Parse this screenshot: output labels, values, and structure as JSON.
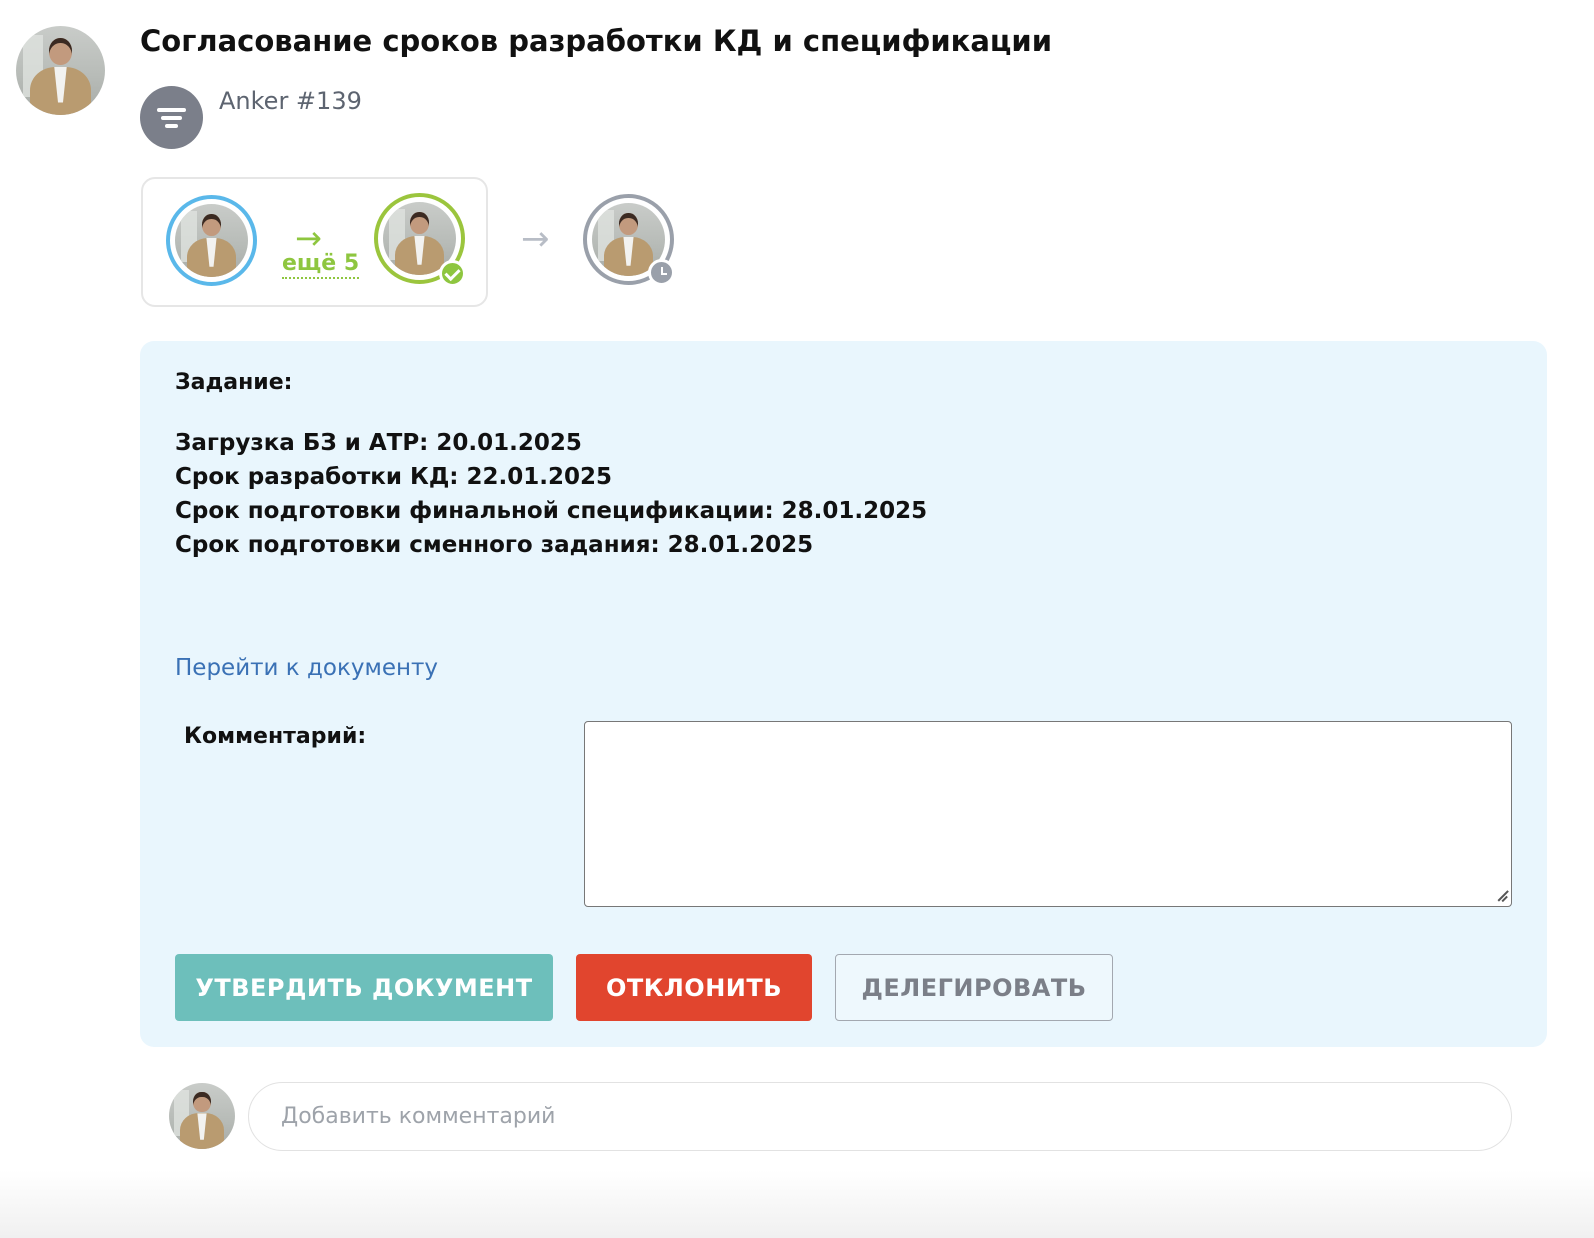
{
  "header": {
    "title": "Согласование сроков разработки КД и спецификации",
    "process_name": "Anker #139",
    "process_icon": "filter-funnel-icon"
  },
  "route": {
    "more_label": "ещё 5",
    "steps": [
      {
        "status": "current",
        "ring_color": "#5ab8ea"
      },
      {
        "status": "approved",
        "ring_color": "#9bc53d",
        "badge_icon": "check-icon"
      },
      {
        "status": "pending",
        "ring_color": "#9aa0aa",
        "badge_icon": "clock-icon"
      }
    ]
  },
  "task": {
    "label": "Задание:",
    "lines": [
      "Загрузка БЗ и АТР: 20.01.2025",
      "Срок разработки КД: 22.01.2025",
      "Срок подготовки финальной спецификации: 28.01.2025",
      "Срок подготовки сменного задания: 28.01.2025"
    ],
    "document_link": "Перейти к документу",
    "comment_label": "Комментарий:",
    "comment_value": ""
  },
  "actions": {
    "approve_label": "Утвердить документ",
    "reject_label": "Отклонить",
    "delegate_label": "Делегировать"
  },
  "footer": {
    "add_comment_placeholder": "Добавить комментарий"
  },
  "colors": {
    "panel_bg": "#e9f6fd",
    "approve": "#6dbfbb",
    "reject": "#e1452e",
    "link": "#3a71b5",
    "accent_green": "#8ec63f"
  }
}
